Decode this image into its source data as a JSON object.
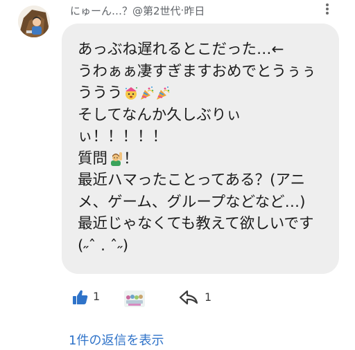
{
  "comment": {
    "author": "にゅーん…？@第2世代",
    "separator": " · ",
    "time": "昨日",
    "message_lines": [
      "あっぶね遅れるとこだった…←",
      "うわぁぁ凄すぎますおめでとうぅぅ",
      "ううう",
      "そしてなんか久しぶりぃ",
      "ぃ！！！！！",
      "質問",
      "最近ハマったことってある？(アニ",
      "メ、ゲーム、グループなどなど…)",
      "最近じゃなくても教えて欲しいです",
      "(˶ˆ . ˆ˶)"
    ],
    "question_suffix": "！",
    "emojis": [
      "party-popper-face-emoji",
      "party-popper-emoji",
      "party-popper-emoji",
      "person-raising-hand-emoji"
    ]
  },
  "actions": {
    "like_count": "1",
    "share_count": "1",
    "like_icon": "thumbs-up-icon",
    "share_icon": "share-arrow-icon",
    "accent_color": "#2f73c9"
  },
  "replies": {
    "link_label": "1件の返信を表示"
  }
}
